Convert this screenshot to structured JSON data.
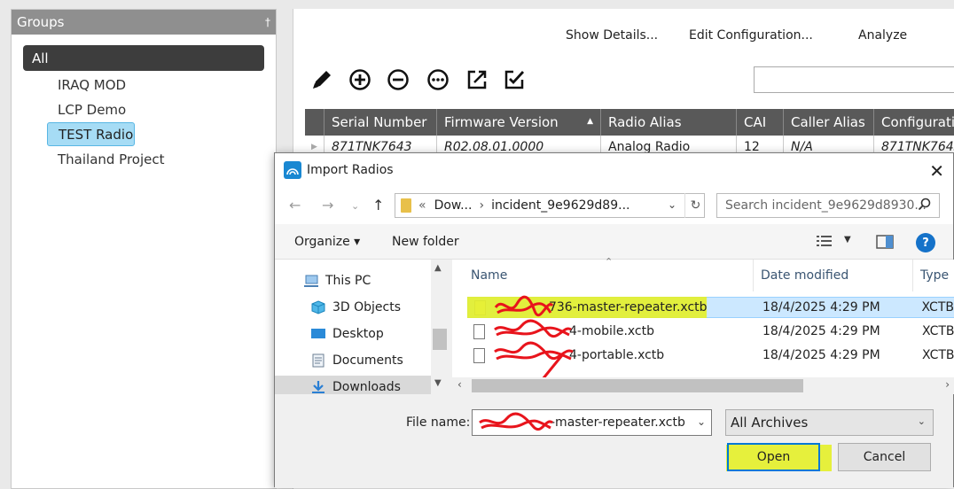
{
  "groups": {
    "header": "Groups",
    "pin_glyph": "†",
    "all_label": "All",
    "items": [
      "IRAQ MOD",
      "LCP Demo",
      "TEST Radio",
      "Thailand Project"
    ]
  },
  "menu": {
    "show_details": "Show Details...",
    "edit_configuration": "Edit Configuration...",
    "analyze": "Analyze"
  },
  "toolbar_icons": [
    "pencil-icon",
    "add-circle-icon",
    "remove-circle-icon",
    "more-circle-icon",
    "export-icon",
    "checkbox-edit-icon"
  ],
  "grid": {
    "columns": [
      "Serial Number",
      "Firmware Version",
      "Radio Alias",
      "CAI",
      "Caller Alias",
      "Configuratio"
    ],
    "row": [
      "871TNK7643",
      "R02.08.01.0000",
      "Analog Radio",
      "12",
      "N/A",
      "871TNK7643"
    ]
  },
  "dialog": {
    "title": "Import Radios",
    "close_glyph": "✕",
    "address_prefix": "«",
    "address_parts": [
      "Dow...",
      "incident_9e9629d89..."
    ],
    "search_placeholder": "Search incident_9e9629d8930...",
    "organize": "Organize ▾",
    "new_folder": "New folder",
    "help": "?",
    "nav_items": [
      "This PC",
      "3D Objects",
      "Desktop",
      "Documents",
      "Downloads"
    ],
    "columns": [
      "Name",
      "Date modified",
      "Type"
    ],
    "files": [
      {
        "name_suffix": "736-master-repeater.xctb",
        "date": "18/4/2025 4:29 PM",
        "type": "XCTB"
      },
      {
        "name_suffix": "4-mobile.xctb",
        "date": "18/4/2025 4:29 PM",
        "type": "XCTB"
      },
      {
        "name_suffix": "4-portable.xctb",
        "date": "18/4/2025 4:29 PM",
        "type": "XCTB"
      }
    ],
    "file_name_label": "File name:",
    "file_name_value": "-master-repeater.xctb",
    "filter_value": "All Archives",
    "open_label": "Open",
    "cancel_label": "Cancel"
  },
  "colors": {
    "highlight": "#e4f028",
    "redaction": "#e8141c",
    "selected_group": "#a6dcf5",
    "grid_header": "#595959"
  }
}
